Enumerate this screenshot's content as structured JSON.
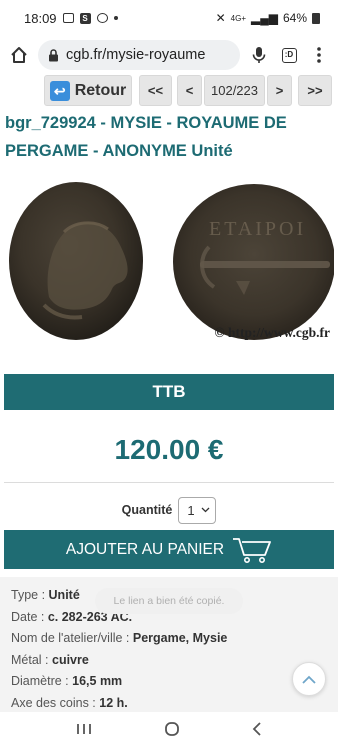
{
  "status_bar": {
    "time": "18:09",
    "network": "4G+",
    "battery": "64%"
  },
  "browser": {
    "url": "cgb.fr/mysie-royaume"
  },
  "nav": {
    "retour_label": "Retour",
    "first_label": "<<",
    "prev_label": "<",
    "page_indicator": "102/223",
    "next_label": ">",
    "last_label": ">>"
  },
  "product": {
    "title": "bgr_729924 - MYSIE - ROYAUME DE PERGAME - ANONYME Unité",
    "watermark": "© http://www.cgb.fr",
    "grade": "TTB",
    "price": "120.00 €",
    "quantity_label": "Quantité",
    "quantity_value": "1",
    "cart_button": "AJOUTER AU PANIER"
  },
  "toast": "Le lien a bien été copié.",
  "details": [
    {
      "label": "Type : ",
      "value": "Unité"
    },
    {
      "label": "Date : ",
      "value": "c. 282-263 AC."
    },
    {
      "label": "Nom de l'atelier/ville : ",
      "value": "Pergame, Mysie"
    },
    {
      "label": "Métal : ",
      "value": "cuivre"
    },
    {
      "label": "Diamètre : ",
      "value": "16,5 mm"
    },
    {
      "label": "Axe des coins : ",
      "value": "12 h."
    }
  ],
  "colors": {
    "accent": "#1f6c73",
    "title": "#1d6b73"
  }
}
